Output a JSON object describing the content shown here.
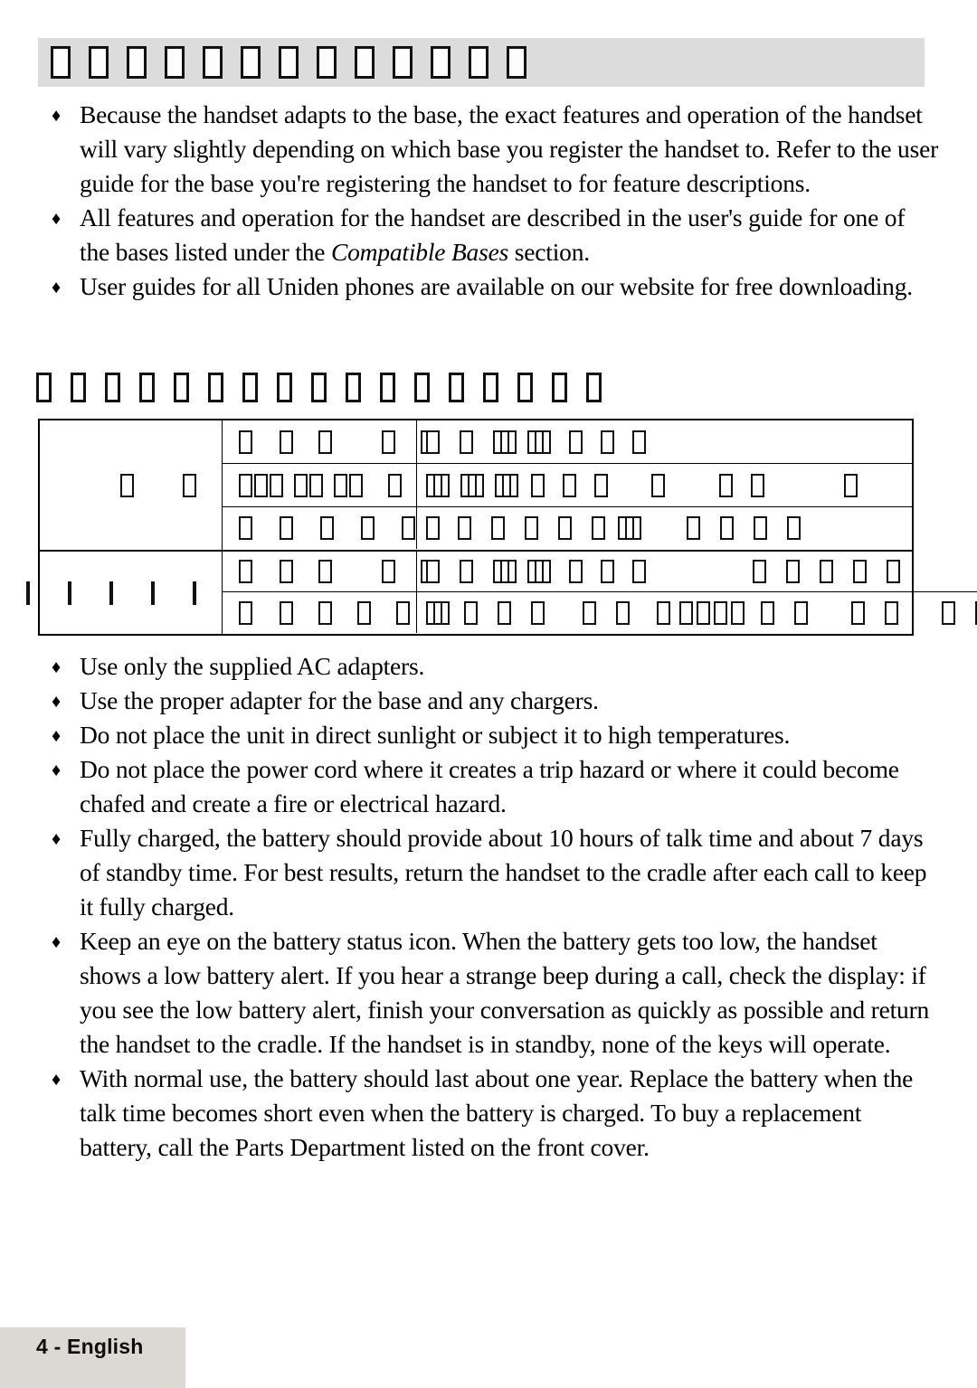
{
  "page": {
    "heading_band": {
      "glyph_type": "missing-glyph-box",
      "glyph_count": 13,
      "background_color": "#dcdcdc"
    },
    "heading_plain": {
      "glyph_type": "missing-glyph-box",
      "glyph_count": 17
    }
  },
  "bullets_top": [
    {
      "marker": "♦",
      "text": "Because the handset adapts to the base, the exact features and operation of the handset will vary slightly depending on which base you register the handset to. Refer to the user guide for the base you're registering the handset to for feature descriptions.",
      "italic_part": ""
    },
    {
      "marker": "♦",
      "text_before": "All features and operation for the handset are described in the user's guide for one of the bases listed under the ",
      "italic_part": "Compatible Bases",
      "text_after": " section."
    },
    {
      "marker": "♦",
      "text": "User guides for all Uniden phones are available on our website for free downloading.",
      "italic_part": ""
    }
  ],
  "bullets_bottom": [
    {
      "marker": "♦",
      "text": "Use only the supplied AC adapters."
    },
    {
      "marker": "♦",
      "text": "Use the proper adapter for the base and any chargers."
    },
    {
      "marker": "♦",
      "text": "Do not place the unit in direct sunlight or subject it to high temperatures."
    },
    {
      "marker": "♦",
      "text": "Do not place the power cord where it creates a trip hazard or where it could become chafed and create a fire or electrical hazard."
    },
    {
      "marker": "♦",
      "text": "Fully charged, the battery should provide about 10 hours of talk time and about 7 days of standby time. For best results, return the handset to the cradle after each call to keep it fully charged."
    },
    {
      "marker": "♦",
      "text": "Keep an eye on the battery status icon. When the battery gets too low, the handset shows a low battery alert. If you hear a strange beep during a call, check the display: if you see the low battery alert, finish your conversation as quickly as possible and return the handset to the cradle. If the handset is in standby, none of the keys will operate."
    },
    {
      "marker": "♦",
      "text": "With normal use, the battery should last about one year. Replace the battery when the talk time becomes short even when the battery is charged. To buy a replacement battery, call the Parts Department listed on the front cover."
    }
  ],
  "table": {
    "glyph_type": "missing-glyph-box",
    "rows": [
      {
        "label_glyphs": [
          {
            "wide": false,
            "gap": 34
          },
          {
            "wide": false,
            "gap": 20
          }
        ],
        "subrows": [
          {
            "col_a": [
              {
                "wide": false,
                "gap": 30
              },
              {
                "wide": false,
                "gap": 28
              },
              {
                "wide": false,
                "gap": 55
              },
              {
                "wide": false,
                "gap": 28
              },
              {
                "wide": false,
                "gap": 0
              }
            ],
            "col_b": [
              {
                "wide": false,
                "gap": 22
              },
              {
                "wide": false,
                "gap": 22
              },
              {
                "wide": true,
                "gap": 12
              },
              {
                "wide": true,
                "gap": 20
              },
              {
                "wide": false,
                "gap": 20
              },
              {
                "wide": false,
                "gap": 20
              },
              {
                "wide": false,
                "gap": 0
              }
            ],
            "divider": true
          },
          {
            "col_a": [
              {
                "wide": false,
                "gap": 2
              },
              {
                "wide": false,
                "gap": 2
              },
              {
                "wide": false,
                "gap": 12
              },
              {
                "wide": false,
                "gap": 2
              },
              {
                "wide": false,
                "gap": 12
              },
              {
                "wide": false,
                "gap": 2
              },
              {
                "wide": false,
                "gap": 28
              },
              {
                "wide": false,
                "gap": 0
              }
            ],
            "col_b": [
              {
                "wide": true,
                "gap": 12
              },
              {
                "wide": true,
                "gap": 12
              },
              {
                "wide": true,
                "gap": 14
              },
              {
                "wide": false,
                "gap": 20
              },
              {
                "wide": false,
                "gap": 20
              },
              {
                "wide": false,
                "gap": 48
              },
              {
                "wide": false,
                "gap": 60
              },
              {
                "wide": false,
                "gap": 20
              },
              {
                "wide": false,
                "gap": 88
              },
              {
                "wide": false,
                "gap": 0
              }
            ],
            "divider": true
          },
          {
            "col_a": [
              {
                "wide": false,
                "gap": 30
              },
              {
                "wide": false,
                "gap": 30
              },
              {
                "wide": false,
                "gap": 30
              },
              {
                "wide": false,
                "gap": 30
              },
              {
                "wide": false,
                "gap": 0
              }
            ],
            "col_b": [
              {
                "wide": false,
                "gap": 20
              },
              {
                "wide": false,
                "gap": 22
              },
              {
                "wide": false,
                "gap": 22
              },
              {
                "wide": false,
                "gap": 22
              },
              {
                "wide": false,
                "gap": 22
              },
              {
                "wide": false,
                "gap": 14
              },
              {
                "wide": true,
                "gap": 50
              },
              {
                "wide": false,
                "gap": 22
              },
              {
                "wide": false,
                "gap": 22
              },
              {
                "wide": false,
                "gap": 22
              },
              {
                "wide": false,
                "gap": 0
              }
            ],
            "divider": false
          }
        ]
      },
      {
        "label_glyphs": [
          {
            "wide": false,
            "gap": 22
          },
          {
            "wide": false,
            "gap": 22
          },
          {
            "wide": false,
            "gap": 22
          },
          {
            "wide": false,
            "gap": 22
          },
          {
            "wide": false,
            "gap": 20
          }
        ],
        "subrows": [
          {
            "col_a": [
              {
                "wide": false,
                "gap": 30
              },
              {
                "wide": false,
                "gap": 28
              },
              {
                "wide": false,
                "gap": 55
              },
              {
                "wide": false,
                "gap": 28
              },
              {
                "wide": false,
                "gap": 0
              }
            ],
            "col_b": [
              {
                "wide": false,
                "gap": 22
              },
              {
                "wide": false,
                "gap": 22
              },
              {
                "wide": true,
                "gap": 12
              },
              {
                "wide": true,
                "gap": 20
              },
              {
                "wide": false,
                "gap": 20
              },
              {
                "wide": false,
                "gap": 20
              },
              {
                "wide": false,
                "gap": 118
              },
              {
                "wide": false,
                "gap": 22
              },
              {
                "wide": false,
                "gap": 22
              },
              {
                "wide": false,
                "gap": 22
              },
              {
                "wide": false,
                "gap": 22
              },
              {
                "wide": false,
                "gap": 0
              }
            ],
            "divider": true
          },
          {
            "col_a": [
              {
                "wide": false,
                "gap": 30
              },
              {
                "wide": false,
                "gap": 28
              },
              {
                "wide": false,
                "gap": 28
              },
              {
                "wide": false,
                "gap": 28
              },
              {
                "wide": false,
                "gap": 28
              },
              {
                "wide": false,
                "gap": 0
              }
            ],
            "col_b": [
              {
                "wide": true,
                "gap": 16
              },
              {
                "wide": false,
                "gap": 22
              },
              {
                "wide": false,
                "gap": 22
              },
              {
                "wide": false,
                "gap": 42
              },
              {
                "wide": false,
                "gap": 22
              },
              {
                "wide": false,
                "gap": 30
              },
              {
                "wide": false,
                "gap": 10
              },
              {
                "wide": false,
                "gap": 4
              },
              {
                "wide": false,
                "gap": 4
              },
              {
                "wide": false,
                "gap": 4
              },
              {
                "wide": false,
                "gap": 18
              },
              {
                "wide": false,
                "gap": 22
              },
              {
                "wide": false,
                "gap": 48
              },
              {
                "wide": false,
                "gap": 22
              },
              {
                "wide": false,
                "gap": 48
              },
              {
                "wide": false,
                "gap": 22
              },
              {
                "wide": false,
                "gap": 0
              }
            ],
            "divider": false
          }
        ]
      }
    ]
  },
  "footer": {
    "label": "4 - English",
    "background_color": "#dcd9d4"
  }
}
